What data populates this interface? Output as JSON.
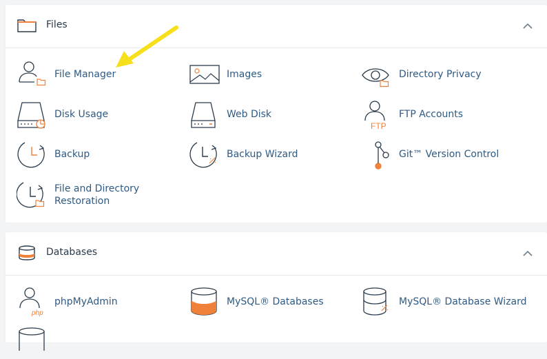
{
  "colors": {
    "accent": "#f0813a",
    "link": "#2e5a84",
    "text": "#293a4a",
    "icon": "#293a4a",
    "arrow": "#f7e01b"
  },
  "files": {
    "title": "Files",
    "icon": "folder-icon",
    "items": [
      {
        "label": "File Manager",
        "icon": "file-manager-icon"
      },
      {
        "label": "Images",
        "icon": "images-icon"
      },
      {
        "label": "Directory Privacy",
        "icon": "directory-privacy-icon"
      },
      {
        "label": "Disk Usage",
        "icon": "disk-usage-icon"
      },
      {
        "label": "Web Disk",
        "icon": "web-disk-icon"
      },
      {
        "label": "FTP Accounts",
        "icon": "ftp-accounts-icon"
      },
      {
        "label": "Backup",
        "icon": "backup-icon"
      },
      {
        "label": "Backup Wizard",
        "icon": "backup-wizard-icon"
      },
      {
        "label": "Git™ Version Control",
        "icon": "git-icon"
      },
      {
        "label": "File and Directory Restoration",
        "icon": "restoration-icon"
      }
    ]
  },
  "databases": {
    "title": "Databases",
    "icon": "database-icon",
    "items": [
      {
        "label": "phpMyAdmin",
        "icon": "phpmyadmin-icon"
      },
      {
        "label": "MySQL® Databases",
        "icon": "mysql-databases-icon"
      },
      {
        "label": "MySQL® Database Wizard",
        "icon": "mysql-wizard-icon"
      }
    ]
  },
  "ftp_icon_text": "FTP",
  "php_icon_text": "php"
}
